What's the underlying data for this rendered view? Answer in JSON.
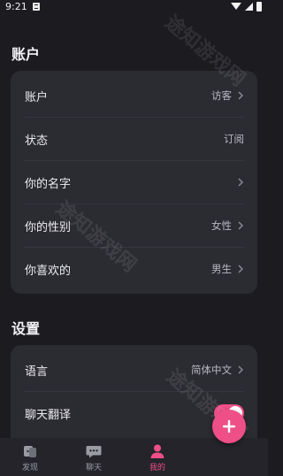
{
  "status_bar": {
    "time": "9:21"
  },
  "account_section": {
    "title": "账户",
    "rows": [
      {
        "label": "账户",
        "value": "访客",
        "chevron": true
      },
      {
        "label": "状态",
        "value": "订阅",
        "chevron": false
      },
      {
        "label": "你的名字",
        "value": "",
        "chevron": true
      },
      {
        "label": "你的性别",
        "value": "女性",
        "chevron": true
      },
      {
        "label": "你喜欢的",
        "value": "男生",
        "chevron": true
      }
    ]
  },
  "settings_section": {
    "title": "设置",
    "rows": [
      {
        "label": "语言",
        "value": "简体中文",
        "chevron": true
      },
      {
        "label": "聊天翻译",
        "toggle_on": true
      }
    ]
  },
  "tab_bar": {
    "tabs": [
      {
        "label": "发现",
        "icon": "discover-icon",
        "active": false
      },
      {
        "label": "聊天",
        "icon": "chat-icon",
        "active": false
      },
      {
        "label": "我的",
        "icon": "profile-icon",
        "active": true
      }
    ]
  },
  "fab": {
    "icon": "plus-icon"
  },
  "watermark": "途知游戏网",
  "colors": {
    "background": "#1b1b20",
    "card": "#2b2b32",
    "accent": "#ee4f86"
  }
}
